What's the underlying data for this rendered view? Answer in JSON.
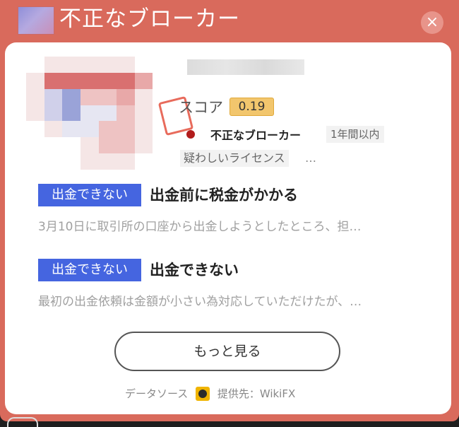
{
  "header": {
    "title": "不正なブローカー",
    "close_symbol": "×"
  },
  "broker": {
    "score_label": "スコア",
    "score_value": "0.19",
    "type_label": "不正なブローカー",
    "period_tag": "1年間以内",
    "license_tag": "疑わしいライセンス",
    "license_more": "…"
  },
  "reviews": [
    {
      "badge": "出金できない",
      "title": "出金前に税金がかかる",
      "text": "3月10日に取引所の口座から出金しようとしたところ、担…"
    },
    {
      "badge": "出金できない",
      "title": "出金できない",
      "text": "最初の出金依頼は金額が小さい為対応していただけたが、…"
    }
  ],
  "more_button": "もっと見る",
  "footer": {
    "source_label": "データソース",
    "provider": "提供先：WikiFX"
  },
  "colors": {
    "header_bg": "#d96a5c",
    "badge_blue": "#4565e0",
    "score_bg": "#f2c66d",
    "flag_red": "#b21c1c"
  },
  "icons": [
    "broker-logo-icon",
    "close-icon",
    "flag-icon",
    "wikifx-logo-icon"
  ]
}
